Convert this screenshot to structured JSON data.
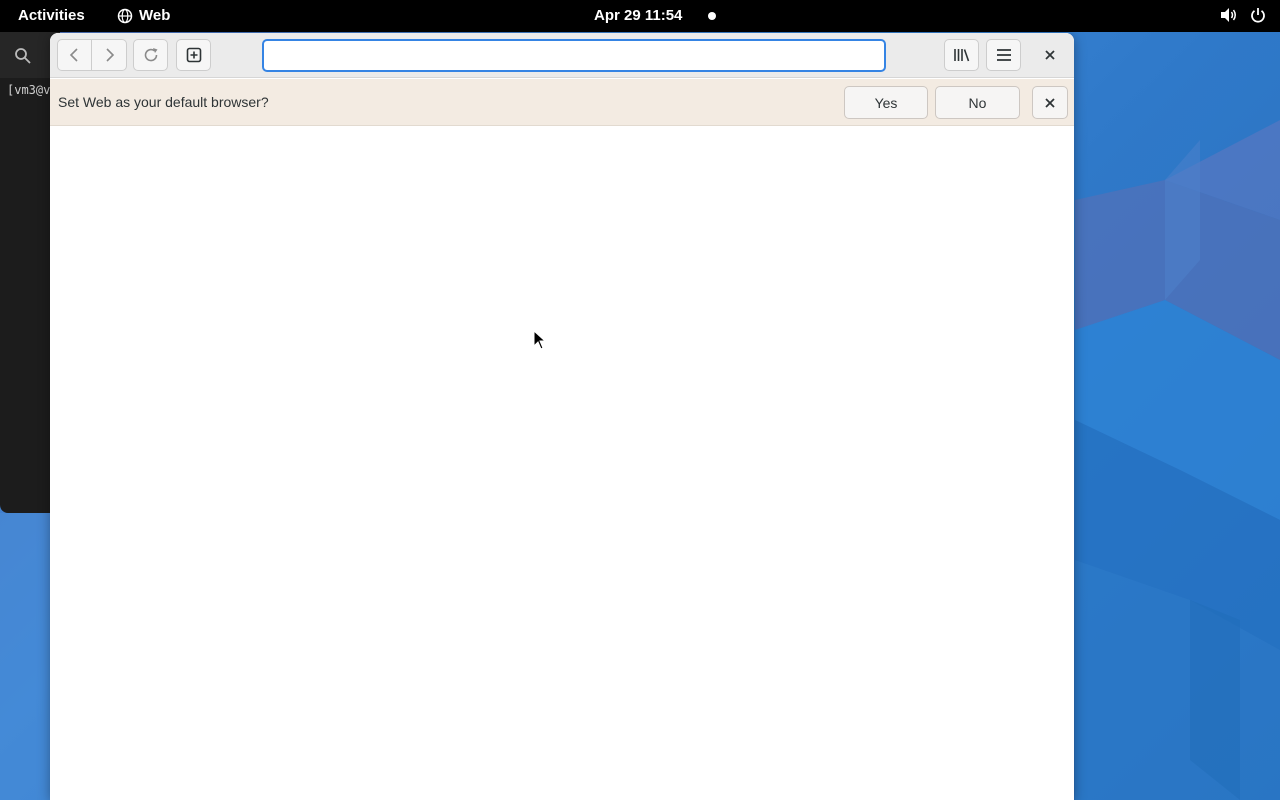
{
  "topbar": {
    "activities_label": "Activities",
    "app_label": "Web",
    "clock": "Apr 29  11:54"
  },
  "terminal": {
    "prompt_line": "[vm3@v"
  },
  "browser": {
    "url_value": "",
    "url_placeholder": ""
  },
  "infobar": {
    "message": "Set Web as your default browser?",
    "yes_label": "Yes",
    "no_label": "No"
  },
  "colors": {
    "accent": "#3584e4",
    "infobar_bg": "#f3ebe2",
    "topbar_bg": "#000000"
  }
}
